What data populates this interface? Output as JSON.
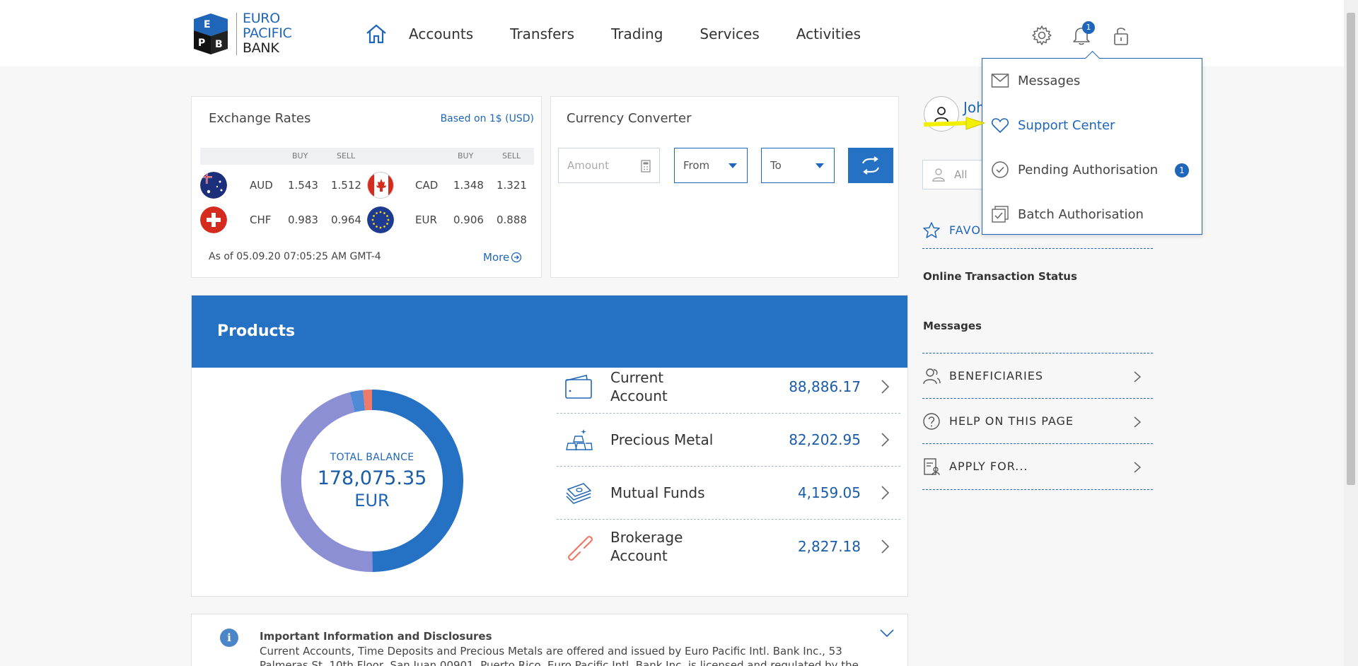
{
  "brand": {
    "line1": "EURO",
    "line2": "PACIFIC",
    "line3": "BANK"
  },
  "nav": {
    "items": [
      "Accounts",
      "Transfers",
      "Trading",
      "Services",
      "Activities"
    ]
  },
  "header": {
    "notification_count": "1"
  },
  "exchange": {
    "title": "Exchange Rates",
    "based_on": "Based on 1$ (USD)",
    "col_buy": "BUY",
    "col_sell": "SELL",
    "rates": [
      {
        "code": "AUD",
        "buy": "1.543",
        "sell": "1.512"
      },
      {
        "code": "CAD",
        "buy": "1.348",
        "sell": "1.321"
      },
      {
        "code": "CHF",
        "buy": "0.983",
        "sell": "0.964"
      },
      {
        "code": "EUR",
        "buy": "0.906",
        "sell": "0.888"
      }
    ],
    "as_of": "As of 05.09.20 07:05:25 AM GMT-4",
    "more": "More"
  },
  "converter": {
    "title": "Currency Converter",
    "amount_placeholder": "Amount",
    "from": "From",
    "to": "To"
  },
  "products": {
    "title": "Products",
    "total_label": "TOTAL BALANCE",
    "total_value": "178,075.35",
    "total_currency": "EUR",
    "items": [
      {
        "name": "Current Account",
        "value": "88,886.17",
        "share": 0.4992
      },
      {
        "name": "Precious Metal",
        "value": "82,202.95",
        "share": 0.4616
      },
      {
        "name": "Mutual Funds",
        "value": "4,159.05",
        "share": 0.0234
      },
      {
        "name": "Brokerage Account",
        "value": "2,827.18",
        "share": 0.0159
      }
    ],
    "colors": [
      "#2571c4",
      "#8d8fd4",
      "#4f8ad6",
      "#f07a6a"
    ]
  },
  "info": {
    "title": "Important Information and Disclosures",
    "text": "Current Accounts, Time Deposits and Precious Metals are offered and issued by Euro Pacific Intl. Bank Inc., 53 Palmeras St, 10th Floor, San Juan 00901, Puerto Rico. Euro Pacific Intl. Bank Inc. is licensed and regulated by the Office of the"
  },
  "sidebar": {
    "username": "Joh",
    "search_placeholder": "All",
    "favorites": "FAVO",
    "online_status": "Online Transaction Status",
    "messages": "Messages",
    "links": [
      "BENEFICIARIES",
      "HELP ON THIS PAGE",
      "APPLY FOR..."
    ]
  },
  "dropdown": {
    "items": [
      {
        "label": "Messages",
        "icon": "envelope-icon"
      },
      {
        "label": "Support Center",
        "icon": "heart-icon"
      },
      {
        "label": "Pending Authorisation",
        "icon": "check-circle-icon",
        "badge": "1"
      },
      {
        "label": "Batch Authorisation",
        "icon": "stacked-check-icon"
      }
    ]
  },
  "theme": {
    "primary": "#2066b8",
    "header_blue": "#2571c4",
    "annotation_arrow": "#f2f000"
  }
}
